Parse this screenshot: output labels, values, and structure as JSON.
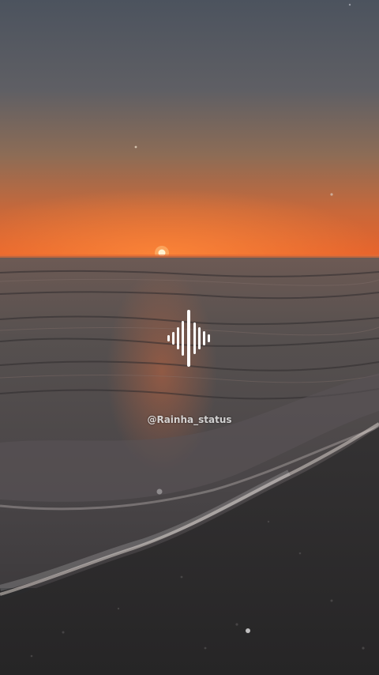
{
  "overlay": {
    "watermark": "@Rainha_status",
    "icon": "audio-waveform-icon"
  },
  "colors": {
    "sky_top": "#4e5560",
    "sky_mid": "#8b6e58",
    "horizon_glow": "#e0662a",
    "sea": "#4a4648",
    "sand": "#2a2929",
    "foam": "#d8d0cc"
  }
}
